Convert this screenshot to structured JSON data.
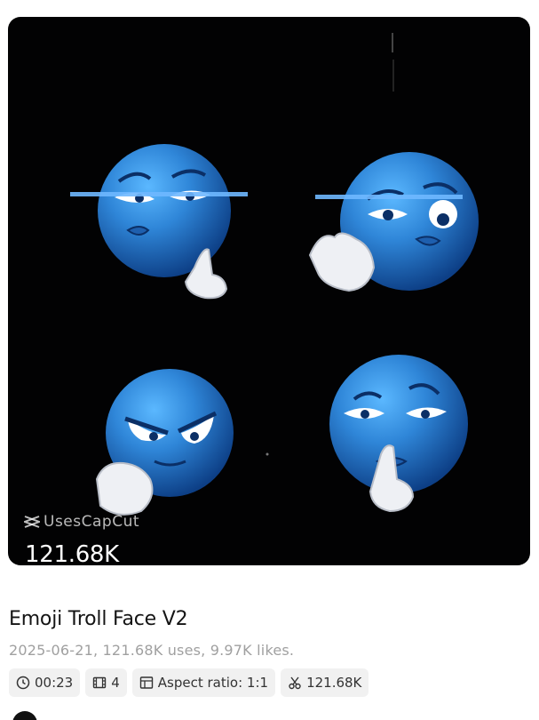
{
  "template": {
    "usage_overlay": "121.68K",
    "watermark_text": "UsesCapCut",
    "title": "Emoji Troll Face V2",
    "meta": "2025-06-21, 121.68K uses, 9.97K likes.",
    "chips": [
      {
        "icon": "clock-icon",
        "label": "00:23"
      },
      {
        "icon": "film-icon",
        "label": "4"
      },
      {
        "icon": "layout-icon",
        "label": "Aspect ratio: 1:1"
      },
      {
        "icon": "scissors-icon",
        "label": "121.68K"
      }
    ]
  },
  "colors": {
    "preview_bg": "#020203",
    "emoji_blue": "#2f86d8",
    "chip_bg": "#f1f1f1",
    "meta_text": "#a0a0a0"
  }
}
